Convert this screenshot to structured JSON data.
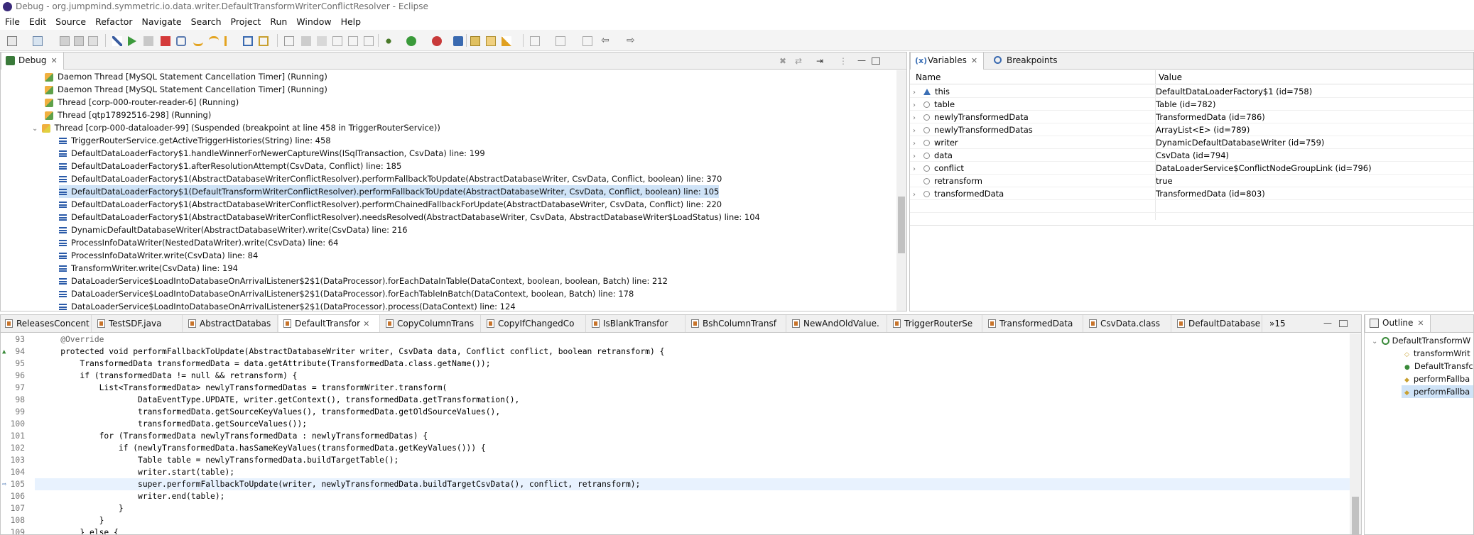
{
  "window": {
    "title": "Debug - org.jumpmind.symmetric.io.data.writer.DefaultTransformWriterConflictResolver - Eclipse"
  },
  "menu": [
    "File",
    "Edit",
    "Source",
    "Refactor",
    "Navigate",
    "Search",
    "Project",
    "Run",
    "Window",
    "Help"
  ],
  "debug_view": {
    "tab_label": "Debug",
    "threads": [
      {
        "label": "Daemon Thread [MySQL Statement Cancellation Timer] (Running)",
        "kind": "thread"
      },
      {
        "label": "Daemon Thread [MySQL Statement Cancellation Timer] (Running)",
        "kind": "thread"
      },
      {
        "label": "Thread [corp-000-router-reader-6] (Running)",
        "kind": "thread"
      },
      {
        "label": "Thread [qtp17892516-298] (Running)",
        "kind": "thread"
      },
      {
        "label": "Thread [corp-000-dataloader-99] (Suspended (breakpoint at line 458 in TriggerRouterService))",
        "kind": "thread-suspended"
      },
      {
        "label": "TriggerRouterService.getActiveTriggerHistories(String) line: 458",
        "kind": "frame"
      },
      {
        "label": "DefaultDataLoaderFactory$1.handleWinnerForNewerCaptureWins(ISqlTransaction, CsvData) line: 199",
        "kind": "frame"
      },
      {
        "label": "DefaultDataLoaderFactory$1.afterResolutionAttempt(CsvData, Conflict) line: 185",
        "kind": "frame"
      },
      {
        "label": "DefaultDataLoaderFactory$1(AbstractDatabaseWriterConflictResolver).performFallbackToUpdate(AbstractDatabaseWriter, CsvData, Conflict, boolean) line: 370",
        "kind": "frame"
      },
      {
        "label": "DefaultDataLoaderFactory$1(DefaultTransformWriterConflictResolver).performFallbackToUpdate(AbstractDatabaseWriter, CsvData, Conflict, boolean) line: 105",
        "kind": "frame",
        "selected": true
      },
      {
        "label": "DefaultDataLoaderFactory$1(AbstractDatabaseWriterConflictResolver).performChainedFallbackForUpdate(AbstractDatabaseWriter, CsvData, Conflict) line: 220",
        "kind": "frame"
      },
      {
        "label": "DefaultDataLoaderFactory$1(AbstractDatabaseWriterConflictResolver).needsResolved(AbstractDatabaseWriter, CsvData, AbstractDatabaseWriter$LoadStatus) line: 104",
        "kind": "frame"
      },
      {
        "label": "DynamicDefaultDatabaseWriter(AbstractDatabaseWriter).write(CsvData) line: 216",
        "kind": "frame"
      },
      {
        "label": "ProcessInfoDataWriter(NestedDataWriter).write(CsvData) line: 64",
        "kind": "frame"
      },
      {
        "label": "ProcessInfoDataWriter.write(CsvData) line: 84",
        "kind": "frame"
      },
      {
        "label": "TransformWriter.write(CsvData) line: 194",
        "kind": "frame"
      },
      {
        "label": "DataLoaderService$LoadIntoDatabaseOnArrivalListener$2$1(DataProcessor).forEachDataInTable(DataContext, boolean, boolean, Batch) line: 212",
        "kind": "frame"
      },
      {
        "label": "DataLoaderService$LoadIntoDatabaseOnArrivalListener$2$1(DataProcessor).forEachTableInBatch(DataContext, boolean, Batch) line: 178",
        "kind": "frame"
      },
      {
        "label": "DataLoaderService$LoadIntoDatabaseOnArrivalListener$2$1(DataProcessor).process(DataContext) line: 124",
        "kind": "frame"
      }
    ]
  },
  "variables_view": {
    "tabs": [
      "Variables",
      "Breakpoints"
    ],
    "columns": [
      "Name",
      "Value"
    ],
    "rows": [
      {
        "name": "this",
        "value": "DefaultDataLoaderFactory$1  (id=758)",
        "icon": "this"
      },
      {
        "name": "table",
        "value": "Table  (id=782)"
      },
      {
        "name": "newlyTransformedData",
        "value": "TransformedData  (id=786)"
      },
      {
        "name": "newlyTransformedDatas",
        "value": "ArrayList<E>  (id=789)"
      },
      {
        "name": "writer",
        "value": "DynamicDefaultDatabaseWriter  (id=759)"
      },
      {
        "name": "data",
        "value": "CsvData  (id=794)"
      },
      {
        "name": "conflict",
        "value": "DataLoaderService$ConflictNodeGroupLink  (id=796)"
      },
      {
        "name": "retransform",
        "value": "true",
        "noexpand": true
      },
      {
        "name": "transformedData",
        "value": "TransformedData  (id=803)"
      }
    ]
  },
  "editor": {
    "tabs": [
      "ReleasesConcent",
      "TestSDF.java",
      "AbstractDatabas",
      "DefaultTransfor",
      "CopyColumnTrans",
      "CopyIfChangedCo",
      "IsBlankTransfor",
      "BshColumnTransf",
      "NewAndOldValue.",
      "TriggerRouterSe",
      "TransformedData",
      "CsvData.class",
      "DefaultDatabase",
      "»15"
    ],
    "active_tab": 3,
    "lines": [
      {
        "n": "93",
        "text": "    @Override"
      },
      {
        "n": "94",
        "text": "    protected void performFallbackToUpdate(AbstractDatabaseWriter writer, CsvData data, Conflict conflict, boolean retransform) {"
      },
      {
        "n": "95",
        "text": "        TransformedData transformedData = data.getAttribute(TransformedData.class.getName());"
      },
      {
        "n": "96",
        "text": "        if (transformedData != null && retransform) {"
      },
      {
        "n": "97",
        "text": "            List<TransformedData> newlyTransformedDatas = transformWriter.transform("
      },
      {
        "n": "98",
        "text": "                    DataEventType.UPDATE, writer.getContext(), transformedData.getTransformation(),"
      },
      {
        "n": "99",
        "text": "                    transformedData.getSourceKeyValues(), transformedData.getOldSourceValues(),"
      },
      {
        "n": "100",
        "text": "                    transformedData.getSourceValues());"
      },
      {
        "n": "101",
        "text": "            for (TransformedData newlyTransformedData : newlyTransformedDatas) {"
      },
      {
        "n": "102",
        "text": "                if (newlyTransformedData.hasSameKeyValues(transformedData.getKeyValues())) {"
      },
      {
        "n": "103",
        "text": "                    Table table = newlyTransformedData.buildTargetTable();"
      },
      {
        "n": "104",
        "text": "                    writer.start(table);"
      },
      {
        "n": "105",
        "text": "                    super.performFallbackToUpdate(writer, newlyTransformedData.buildTargetCsvData(), conflict, retransform);"
      },
      {
        "n": "106",
        "text": "                    writer.end(table);"
      },
      {
        "n": "107",
        "text": "                }"
      },
      {
        "n": "108",
        "text": "            }"
      },
      {
        "n": "109",
        "text": "        } else {"
      }
    ]
  },
  "outline": {
    "tab_label": "Outline",
    "items": [
      "DefaultTransformW",
      "transformWrit",
      "DefaultTransfc",
      "performFallba",
      "performFallba"
    ]
  }
}
